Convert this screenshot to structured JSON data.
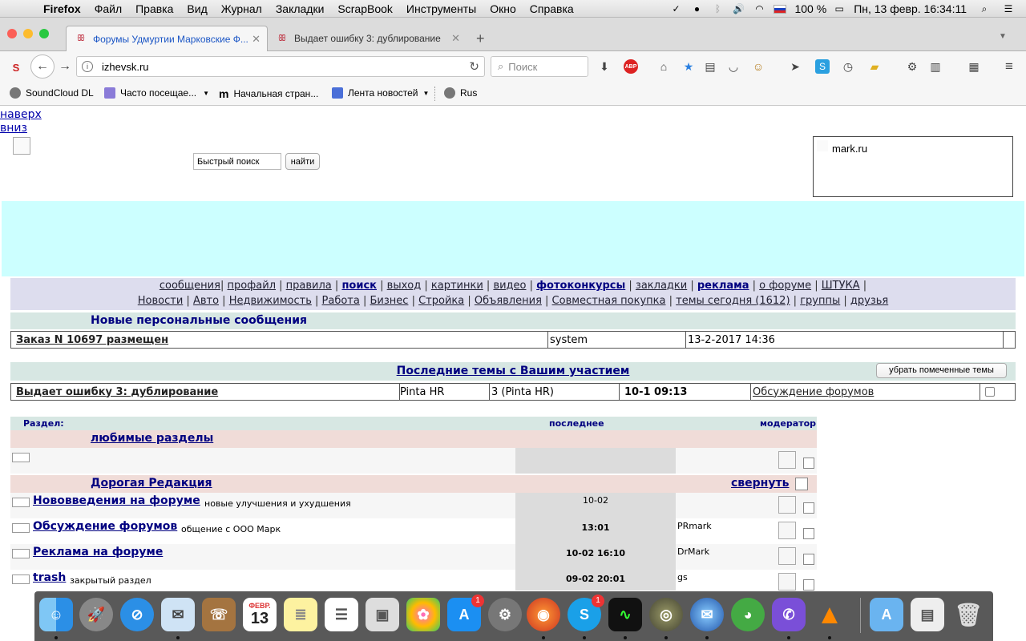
{
  "menubar": {
    "app": "Firefox",
    "items": [
      "Файл",
      "Правка",
      "Вид",
      "Журнал",
      "Закладки",
      "ScrapBook",
      "Инструменты",
      "Окно",
      "Справка"
    ],
    "battery": "100 %",
    "datetime": "Пн, 13 февр.  16:34:11"
  },
  "tabs": [
    {
      "title": "Форумы Удмуртии Марковские Ф...",
      "active": true
    },
    {
      "title": "Выдает ошибку 3: дублирование",
      "active": false
    }
  ],
  "nav": {
    "url": "izhevsk.ru",
    "search_placeholder": "Поиск"
  },
  "bookmarks": [
    "SoundCloud DL",
    "Часто посещае...",
    "Начальная стран...",
    "Лента новостей",
    "Rus"
  ],
  "page": {
    "up_link": "наверх",
    "down_link": "вниз",
    "quick_search": "Быстрый поиск",
    "find_button": "найти",
    "mark_label": "mark.ru",
    "topnav_row1": [
      {
        "t": "сообщения",
        "b": false
      },
      {
        "t": "профайл",
        "b": false
      },
      {
        "t": "правила",
        "b": false
      },
      {
        "t": "поиск",
        "b": true
      },
      {
        "t": "выход",
        "b": false
      },
      {
        "t": "картинки",
        "b": false
      },
      {
        "t": "видео",
        "b": false
      },
      {
        "t": "фотоконкурсы",
        "b": true
      },
      {
        "t": "закладки",
        "b": false
      },
      {
        "t": "реклама",
        "b": true
      },
      {
        "t": "о форуме",
        "b": false
      },
      {
        "t": "ШТУКА",
        "b": false
      }
    ],
    "topnav_row2": [
      "Новости",
      "Авто",
      "Недвижимость",
      "Работа",
      "Бизнес",
      "Стройка",
      "Объявления",
      "Совместная покупка",
      "темы сегодня (1612)",
      "группы",
      "друзья"
    ],
    "pm_title": "Новые персональные сообщения",
    "pm_row": {
      "subject": "Заказ N 10697 размещен",
      "from": "system",
      "date": "13-2-2017 14:36"
    },
    "topics_title": "Последние темы с Вашим участием",
    "remove_button": "убрать помеченные темы",
    "topic_row": {
      "subject": "Выдает ошибку 3: дублирование",
      "author": "Pinta HR",
      "replies": "3 (Pinta HR)",
      "time": "10-1 09:13",
      "forum": "Обсуждение форумов"
    },
    "forum_head": {
      "section": "Раздел:",
      "last": "последнее",
      "moderator": "модератор"
    },
    "group1": "любимые разделы",
    "group2": "Дорогая Редакция",
    "collapse": "свернуть",
    "forums": [
      {
        "title": "Нововведения на форуме",
        "desc": "новые улучшения и ухудшения",
        "last": "10-02",
        "mod": ""
      },
      {
        "title": "Обсуждение форумов",
        "desc": "общение с ООО Марк",
        "last": "13:01",
        "mod": "PRmark"
      },
      {
        "title": "Реклама на форуме",
        "desc": "",
        "last": "10-02 16:10",
        "mod": "DrMark"
      },
      {
        "title": "trash",
        "desc": "закрытый раздел",
        "last": "09-02 20:01",
        "mod": "gs"
      }
    ]
  },
  "dock": {
    "calendar_month": "ФЕВР.",
    "calendar_day": "13",
    "appstore_badge": "1",
    "skype_badge": "1"
  }
}
